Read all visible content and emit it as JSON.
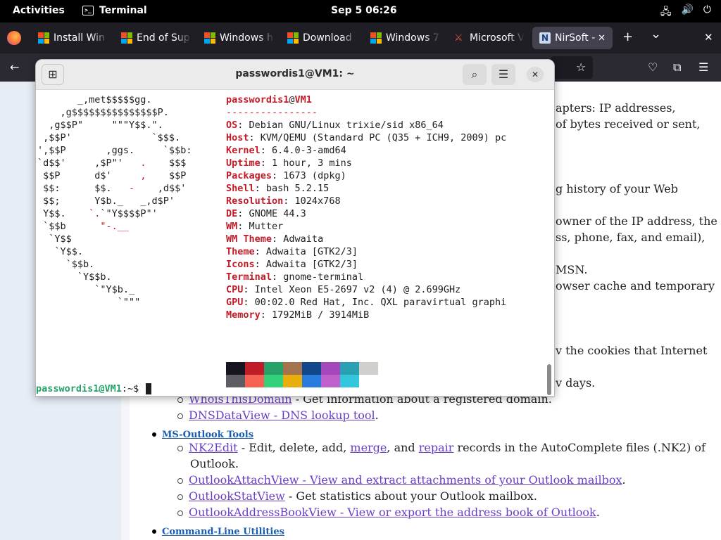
{
  "topbar": {
    "activities": "Activities",
    "app": "Terminal",
    "clock": "Sep 5  06:26",
    "tray": [
      {
        "icon": "network-icon",
        "glyph": "🖧"
      },
      {
        "icon": "volume-icon",
        "glyph": "🔊"
      },
      {
        "icon": "power-icon",
        "glyph": "⏻"
      }
    ]
  },
  "browser": {
    "tabs": [
      {
        "label": "Install Win",
        "favicon": "windows"
      },
      {
        "label": "End of Sup",
        "favicon": "windows"
      },
      {
        "label": "Windows h",
        "favicon": "windows"
      },
      {
        "label": "Download",
        "favicon": "windows"
      },
      {
        "label": "Windows 7",
        "favicon": "windows"
      },
      {
        "label": "Microsoft V",
        "favicon": "sword"
      },
      {
        "label": "NirSoft -",
        "favicon": "n"
      }
    ],
    "new_tab": "+",
    "list_tabs": "⌄",
    "close_window": "✕",
    "tab_close": "✕"
  },
  "page": {
    "right_fragments": [
      "apters: IP addresses,",
      "of bytes received or sent,",
      "g history of your Web",
      "owner of the IP address, the",
      "ss, phone, fax, and email),",
      "MSN.",
      "owser cache and temporary",
      "v the cookies that Internet",
      "v days."
    ],
    "whois_link": "WhoisThisDomain",
    "whois_desc": " - Get information about a registered domain.",
    "dns_link": "DNSDataView - DNS lookup tool",
    "dns_tail": ".",
    "outlook_section": "MS-Outlook Tools",
    "nk2_link": "NK2Edit",
    "nk2_a": " - Edit, delete, add, ",
    "merge_link": "merge",
    "nk2_b": ", and ",
    "repair_link": "repair",
    "nk2_c": " records in the AutoComplete files (.NK2) of",
    "nk2_d": "Outlook.",
    "attach_link": "OutlookAttachView - View and extract attachments of your Outlook mailbox",
    "attach_tail": ".",
    "stat_link": "OutlookStatView",
    "stat_desc": " - Get statistics about your Outlook mailbox.",
    "addr_link": "OutlookAddressBookView - View or export the address book of Outlook",
    "addr_tail": ".",
    "cmd_section": "Command-Line Utilities"
  },
  "terminal": {
    "title": "passwordis1@VM1: ~",
    "user": "passwordis1",
    "at": "@",
    "host": "VM1",
    "separator": "----------------",
    "info": [
      {
        "key": "OS",
        "value": "Debian GNU/Linux trixie/sid x86_64"
      },
      {
        "key": "Host",
        "value": "KVM/QEMU (Standard PC (Q35 + ICH9, 2009) pc"
      },
      {
        "key": "Kernel",
        "value": "6.4.0-3-amd64"
      },
      {
        "key": "Uptime",
        "value": "1 hour, 3 mins"
      },
      {
        "key": "Packages",
        "value": "1673 (dpkg)"
      },
      {
        "key": "Shell",
        "value": "bash 5.2.15"
      },
      {
        "key": "Resolution",
        "value": "1024x768"
      },
      {
        "key": "DE",
        "value": "GNOME 44.3"
      },
      {
        "key": "WM",
        "value": "Mutter"
      },
      {
        "key": "WM Theme",
        "value": "Adwaita"
      },
      {
        "key": "Theme",
        "value": "Adwaita [GTK2/3]"
      },
      {
        "key": "Icons",
        "value": "Adwaita [GTK2/3]"
      },
      {
        "key": "Terminal",
        "value": "gnome-terminal"
      },
      {
        "key": "CPU",
        "value": "Intel Xeon E5-2697 v2 (4) @ 2.699GHz"
      },
      {
        "key": "GPU",
        "value": "00:02.0 Red Hat, Inc. QXL paravirtual graphi"
      },
      {
        "key": "Memory",
        "value": "1792MiB / 3914MiB"
      }
    ],
    "palette_top": [
      "#171421",
      "#c01c28",
      "#26a269",
      "#a2734c",
      "#12488b",
      "#a347ba",
      "#2aa1b3",
      "#d0cfcc"
    ],
    "palette_bottom": [
      "#5e5c64",
      "#f66151",
      "#33d17a",
      "#e9ad0c",
      "#2a7bde",
      "#c061cb",
      "#33c7de"
    ],
    "prompt_user": "passwordis1@VM1",
    "prompt_tail": ":~$ "
  }
}
